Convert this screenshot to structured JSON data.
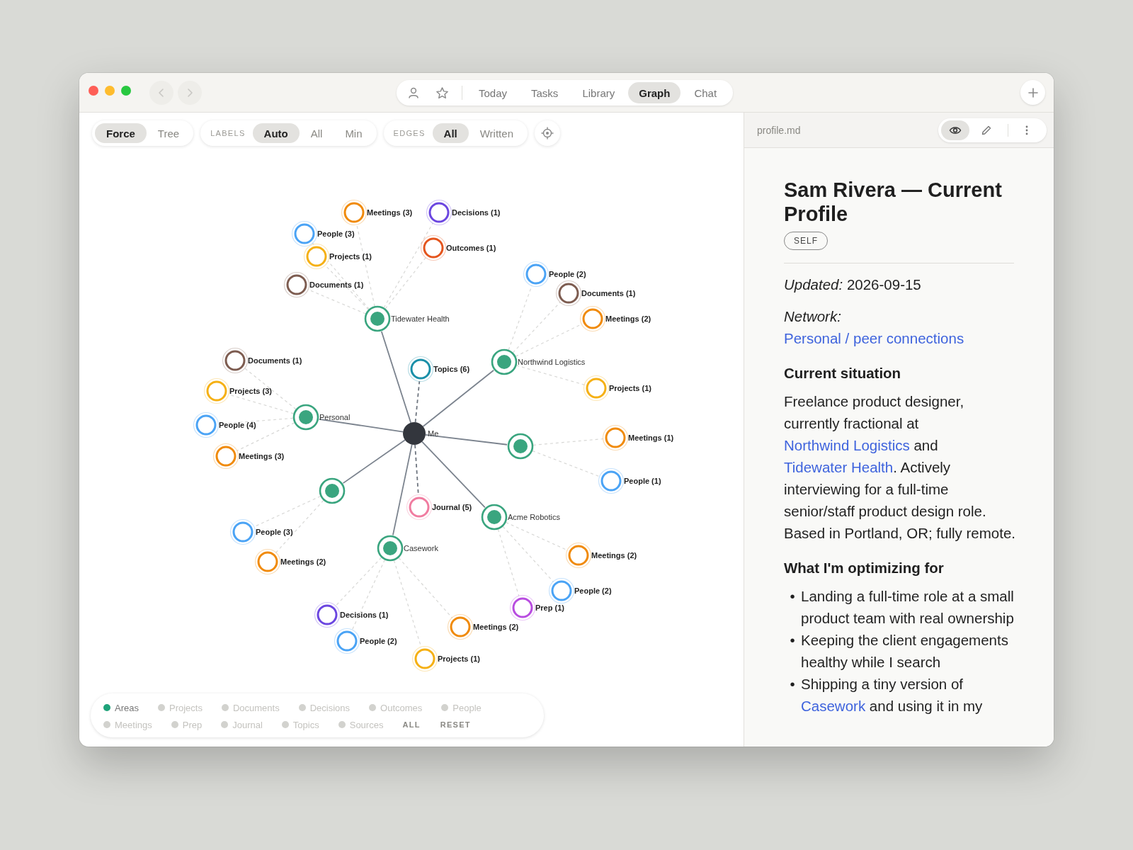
{
  "toolbar": {
    "nav_buttons": [
      {
        "kind": "back",
        "disabled": true
      },
      {
        "kind": "forward",
        "disabled": true
      }
    ],
    "icons": [
      {
        "kind": "person"
      },
      {
        "kind": "star"
      }
    ],
    "tabs": [
      {
        "label": "Today",
        "selected": false
      },
      {
        "label": "Tasks",
        "selected": false
      },
      {
        "label": "Library",
        "selected": false
      },
      {
        "label": "Graph",
        "selected": true
      },
      {
        "label": "Chat",
        "selected": false
      }
    ]
  },
  "graph_controls": {
    "layout": [
      {
        "label": "Force",
        "selected": true
      },
      {
        "label": "Tree",
        "selected": false
      }
    ],
    "labels": {
      "caption": "LABELS",
      "options": [
        {
          "label": "Auto",
          "selected": true
        },
        {
          "label": "All",
          "selected": false
        },
        {
          "label": "Min",
          "selected": false
        }
      ]
    },
    "edges": {
      "caption": "EDGES",
      "options": [
        {
          "label": "All",
          "selected": true
        },
        {
          "label": "Written",
          "selected": false
        }
      ]
    }
  },
  "graph": {
    "center": {
      "label": "Me"
    },
    "nodes": [
      {
        "kind": "area",
        "label": "Tidewater Health",
        "color": "#3aa57f",
        "children": [
          {
            "label": "People (3)",
            "color": "#4aa3f5"
          },
          {
            "label": "Meetings (3)",
            "color": "#f08a0a"
          },
          {
            "label": "Decisions (1)",
            "color": "#6b46e0"
          },
          {
            "label": "Outcomes (1)",
            "color": "#e4541c"
          },
          {
            "label": "Projects (1)",
            "color": "#f5b014"
          },
          {
            "label": "Documents (1)",
            "color": "#7d5c50"
          }
        ]
      },
      {
        "kind": "item",
        "label": "Topics (6)",
        "color": "#1a8fa8"
      },
      {
        "kind": "area",
        "label": "Northwind Logistics",
        "color": "#3aa57f",
        "children": [
          {
            "label": "People (2)",
            "color": "#4aa3f5"
          },
          {
            "label": "Documents (1)",
            "color": "#7d5c50"
          },
          {
            "label": "Meetings (2)",
            "color": "#f08a0a"
          },
          {
            "label": "Projects (1)",
            "color": "#f5b014"
          }
        ]
      },
      {
        "kind": "area",
        "label": "Personal",
        "color": "#3aa57f",
        "children": [
          {
            "label": "Documents (1)",
            "color": "#7d5c50"
          },
          {
            "label": "Projects (3)",
            "color": "#f5b014"
          },
          {
            "label": "People (4)",
            "color": "#4aa3f5"
          },
          {
            "label": "Meetings (3)",
            "color": "#f08a0a"
          }
        ]
      },
      {
        "kind": "area",
        "color": "#3aa57f",
        "children": [
          {
            "label": "Meetings (1)",
            "color": "#f08a0a"
          },
          {
            "label": "People (1)",
            "color": "#4aa3f5"
          }
        ]
      },
      {
        "kind": "area",
        "color": "#3aa57f",
        "children": [
          {
            "label": "People (3)",
            "color": "#4aa3f5"
          },
          {
            "label": "Meetings (2)",
            "color": "#f08a0a"
          }
        ]
      },
      {
        "kind": "item",
        "label": "Journal (5)",
        "color": "#f07ca0"
      },
      {
        "kind": "area",
        "label": "Acme Robotics",
        "color": "#3aa57f",
        "children": [
          {
            "label": "Meetings (2)",
            "color": "#f08a0a"
          },
          {
            "label": "People (2)",
            "color": "#4aa3f5"
          },
          {
            "label": "Prep (1)",
            "color": "#b84ce0"
          }
        ]
      },
      {
        "kind": "area",
        "label": "Casework",
        "color": "#3aa57f",
        "children": [
          {
            "label": "Decisions (1)",
            "color": "#6b46e0"
          },
          {
            "label": "People (2)",
            "color": "#4aa3f5"
          },
          {
            "label": "Projects (1)",
            "color": "#f5b014"
          },
          {
            "label": "Meetings (2)",
            "color": "#f08a0a"
          }
        ]
      }
    ]
  },
  "legend": {
    "items": [
      {
        "label": "Areas",
        "on": true,
        "color": "#1fa37a"
      },
      {
        "label": "Projects",
        "on": false
      },
      {
        "label": "Documents",
        "on": false
      },
      {
        "label": "Decisions",
        "on": false
      },
      {
        "label": "Outcomes",
        "on": false
      },
      {
        "label": "People",
        "on": false
      },
      {
        "label": "Meetings",
        "on": false
      },
      {
        "label": "Prep",
        "on": false
      },
      {
        "label": "Journal",
        "on": false
      },
      {
        "label": "Topics",
        "on": false
      },
      {
        "label": "Sources",
        "on": false
      }
    ],
    "actions": [
      "ALL",
      "RESET"
    ]
  },
  "document": {
    "filename": "profile.md",
    "modes": [
      {
        "kind": "view",
        "selected": true
      },
      {
        "kind": "edit",
        "selected": false
      }
    ],
    "title": "Sam Rivera — Current Profile",
    "tag": "SELF",
    "blocks": [
      {
        "kind": "meta",
        "parts": [
          {
            "kind": "text",
            "text": "*Updated:* 2026-09-15"
          }
        ]
      },
      {
        "kind": "meta",
        "parts": [
          {
            "kind": "text",
            "text": "*Network:* "
          },
          {
            "kind": "link",
            "text": "Personal / peer connections"
          }
        ]
      },
      {
        "kind": "heading",
        "text": "Current situation"
      },
      {
        "kind": "paragraph",
        "parts": [
          {
            "kind": "text",
            "text": "Freelance product designer, currently fractional at "
          },
          {
            "kind": "link",
            "text": "Northwind Logistics"
          },
          {
            "kind": "text",
            "text": " and "
          },
          {
            "kind": "link",
            "text": "Tidewater Health"
          },
          {
            "kind": "text",
            "text": ". Actively interviewing for a full-time senior/staff product design role. Based in Portland, OR; fully remote."
          }
        ]
      },
      {
        "kind": "heading",
        "text": "What I'm optimizing for"
      },
      {
        "kind": "list",
        "items": [
          {
            "marker": "•",
            "parts": [
              {
                "kind": "text",
                "text": "Landing a full-time role at a small product team with real ownership"
              }
            ]
          },
          {
            "marker": "•",
            "parts": [
              {
                "kind": "text",
                "text": "Keeping the client engagements healthy while I search"
              }
            ]
          },
          {
            "marker": "•",
            "parts": [
              {
                "kind": "text",
                "text": "Shipping a tiny version of "
              },
              {
                "kind": "link",
                "text": "Casework"
              },
              {
                "kind": "text",
                "text": " and using it in my"
              }
            ]
          }
        ]
      }
    ]
  }
}
